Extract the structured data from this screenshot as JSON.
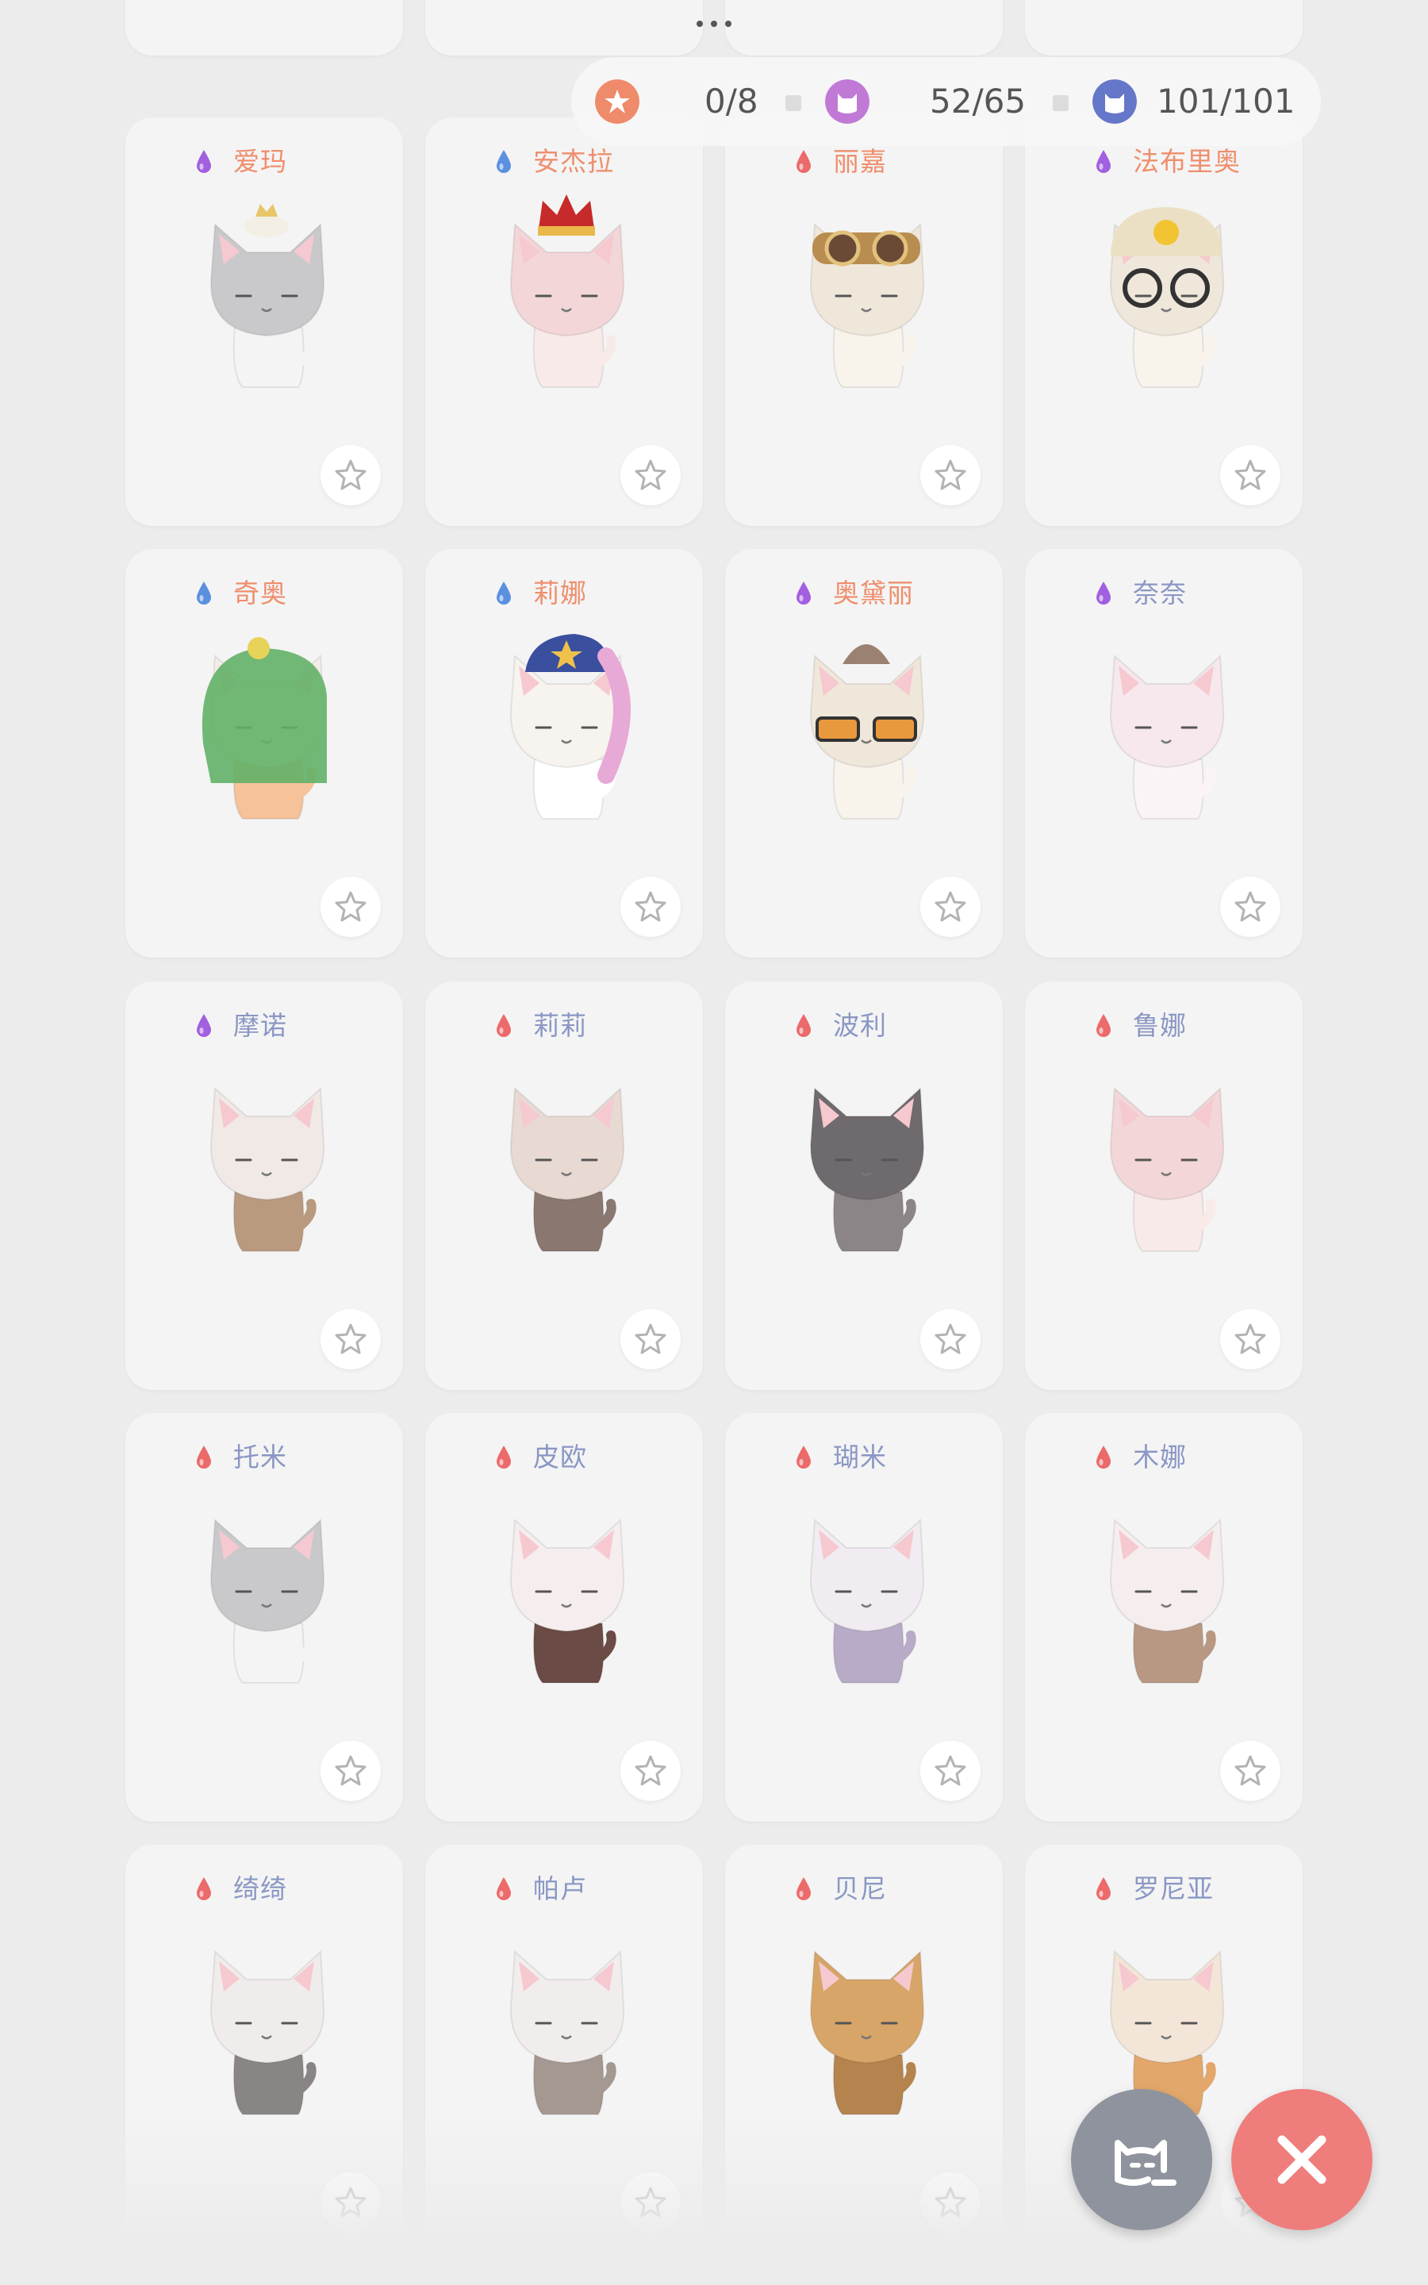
{
  "stats": {
    "favorites": {
      "value": "0/8",
      "icon": "star-badge-icon",
      "color": "#ef8a6a"
    },
    "cats": {
      "value": "52/65",
      "icon": "cat-badge-icon",
      "color": "#c179d6"
    },
    "total": {
      "value": "101/101",
      "icon": "cat-shield-badge-icon",
      "color": "#6577c9"
    }
  },
  "drop_colors": {
    "purple": "#a25fe0",
    "blue": "#5b8fe0",
    "red": "#ec6a6a"
  },
  "cats": [
    {
      "name": "爱玛",
      "drop": "purple",
      "name_color": "#ef8e6d",
      "coat": "gray-white",
      "accessory": "crown-small"
    },
    {
      "name": "安杰拉",
      "drop": "blue",
      "name_color": "#ef8e6d",
      "coat": "pink",
      "accessory": "king-crown"
    },
    {
      "name": "丽嘉",
      "drop": "red",
      "name_color": "#ef8e6d",
      "coat": "cream",
      "accessory": "aviator-goggles"
    },
    {
      "name": "法布里奥",
      "drop": "purple",
      "name_color": "#ef8e6d",
      "coat": "cream",
      "accessory": "miner-helmet"
    },
    {
      "name": "奇奥",
      "drop": "blue",
      "name_color": "#ef8e6d",
      "coat": "white-orange",
      "accessory": "frog-hood"
    },
    {
      "name": "莉娜",
      "drop": "blue",
      "name_color": "#ef8e6d",
      "coat": "white",
      "accessory": "police-cap"
    },
    {
      "name": "奥黛丽",
      "drop": "purple",
      "name_color": "#ef8e6d",
      "coat": "cream",
      "accessory": "sunglasses"
    },
    {
      "name": "奈奈",
      "drop": "purple",
      "name_color": "#8a97c4",
      "coat": "light-pink",
      "accessory": "none"
    },
    {
      "name": "摩诺",
      "drop": "purple",
      "name_color": "#8a97c4",
      "coat": "calico",
      "accessory": "none"
    },
    {
      "name": "莉莉",
      "drop": "red",
      "name_color": "#8a97c4",
      "coat": "brown-mask",
      "accessory": "none"
    },
    {
      "name": "波利",
      "drop": "red",
      "name_color": "#8a97c4",
      "coat": "dark-gray",
      "accessory": "none"
    },
    {
      "name": "鲁娜",
      "drop": "red",
      "name_color": "#8a97c4",
      "coat": "pink",
      "accessory": "none"
    },
    {
      "name": "托米",
      "drop": "red",
      "name_color": "#8a97c4",
      "coat": "gray-white",
      "accessory": "none"
    },
    {
      "name": "皮欧",
      "drop": "red",
      "name_color": "#8a97c4",
      "coat": "brown-white",
      "accessory": "none"
    },
    {
      "name": "瑚米",
      "drop": "red",
      "name_color": "#8a97c4",
      "coat": "lilac",
      "accessory": "none"
    },
    {
      "name": "木娜",
      "drop": "red",
      "name_color": "#8a97c4",
      "coat": "white-brown",
      "accessory": "none"
    },
    {
      "name": "绮绮",
      "drop": "red",
      "name_color": "#8a97c4",
      "coat": "gray-tall",
      "accessory": "none"
    },
    {
      "name": "帕卢",
      "drop": "red",
      "name_color": "#8a97c4",
      "coat": "gray-tabby",
      "accessory": "none"
    },
    {
      "name": "贝尼",
      "drop": "red",
      "name_color": "#8a97c4",
      "coat": "orange-tabby",
      "accessory": "none"
    },
    {
      "name": "罗尼亚",
      "drop": "red",
      "name_color": "#8a97c4",
      "coat": "cream-orange",
      "accessory": "none"
    }
  ],
  "buttons": {
    "cat_fab_icon": "cat-face-icon",
    "close_icon": "close-icon"
  }
}
